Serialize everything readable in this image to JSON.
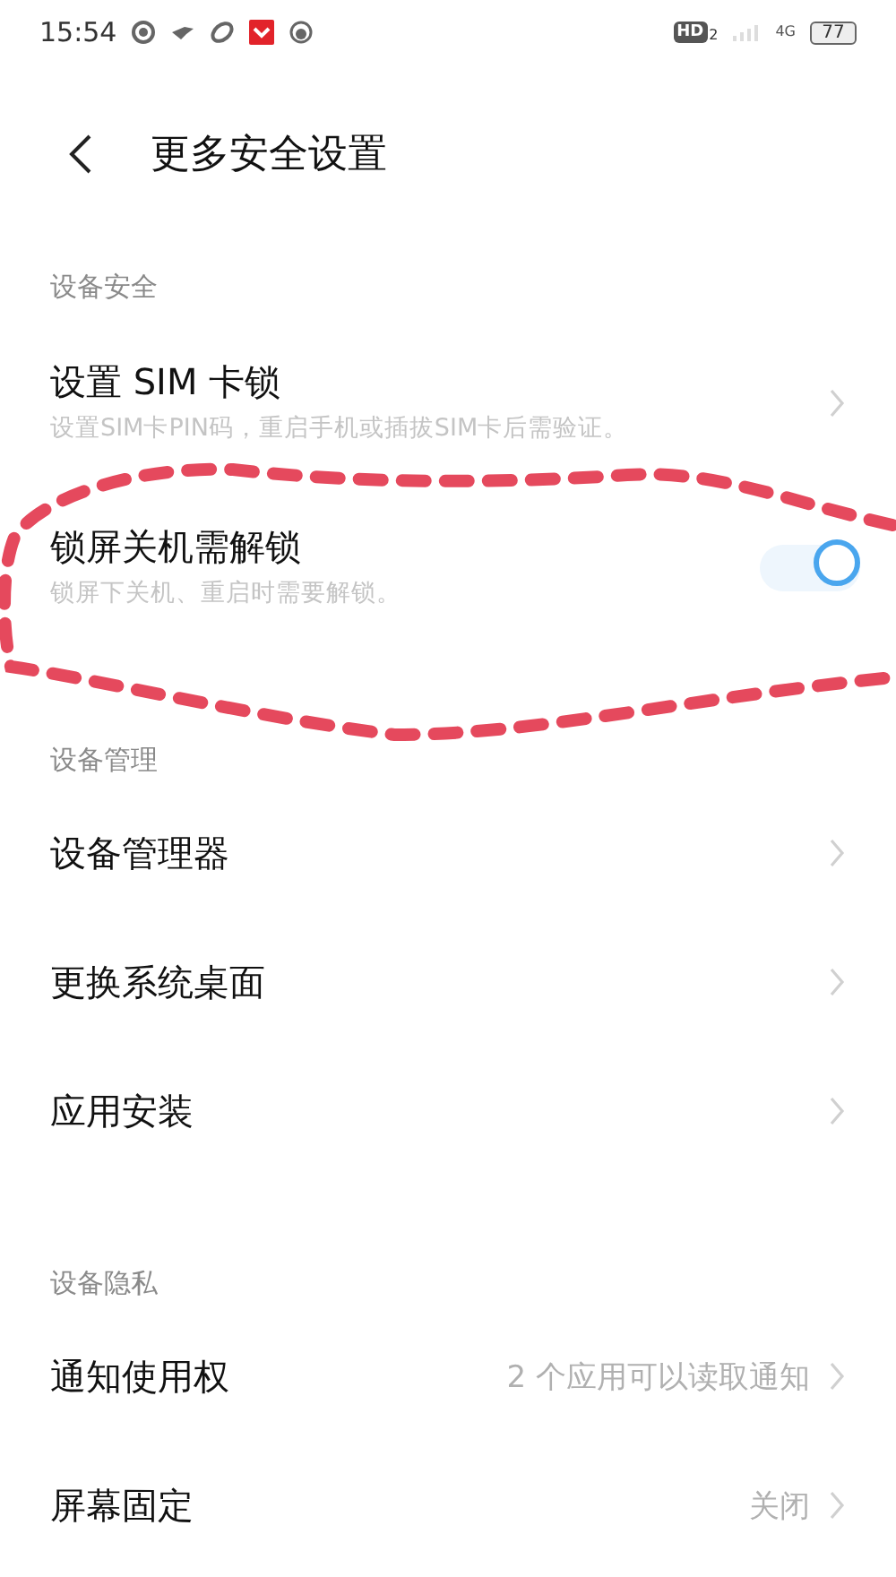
{
  "status_bar": {
    "time": "15:54",
    "hd_label": "HD",
    "hd_sub": "2",
    "network": "4G",
    "battery": "77"
  },
  "header": {
    "title": "更多安全设置"
  },
  "sections": [
    {
      "title": "设备安全",
      "items": [
        {
          "kind": "link",
          "title": "设置 SIM 卡锁",
          "subtitle": "设置SIM卡PIN码，重启手机或插拔SIM卡后需验证。"
        },
        {
          "kind": "toggle",
          "title": "锁屏关机需解锁",
          "subtitle": "锁屏下关机、重启时需要解锁。",
          "on": true
        }
      ]
    },
    {
      "title": "设备管理",
      "items": [
        {
          "kind": "link",
          "title": "设备管理器"
        },
        {
          "kind": "link",
          "title": "更换系统桌面"
        },
        {
          "kind": "link",
          "title": "应用安装"
        }
      ]
    },
    {
      "title": "设备隐私",
      "items": [
        {
          "kind": "link",
          "title": "通知使用权",
          "value": "2 个应用可以读取通知"
        },
        {
          "kind": "link",
          "title": "屏幕固定",
          "value": "关闭"
        }
      ]
    }
  ]
}
